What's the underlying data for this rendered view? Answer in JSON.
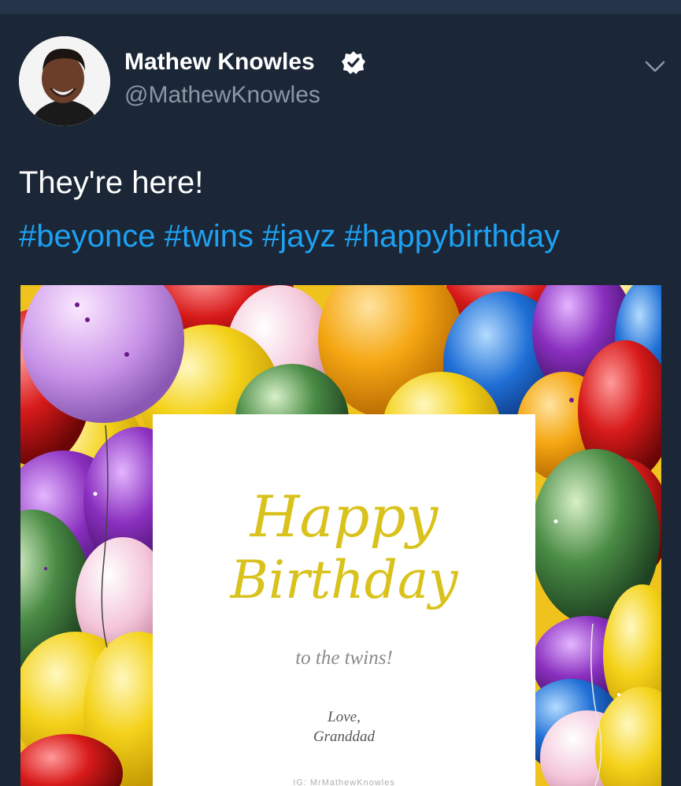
{
  "tweet": {
    "author_name": "Mathew Knowles",
    "handle": "@MathewKnowles",
    "text": "They're here!",
    "hashtags": [
      "#beyonce",
      "#twins",
      "#jayz",
      "#happybirthday"
    ]
  },
  "icons": {
    "verified": "verified-badge-icon",
    "menu": "chevron-down-icon"
  },
  "media": {
    "card": {
      "line1": "Happy",
      "line2": "Birthday",
      "subtitle": "to the twins!",
      "love": "Love,",
      "signature": "Granddad",
      "watermark": "IG: MrMathewKnowles"
    }
  },
  "colors": {
    "background": "#1b2636",
    "hashtag": "#1da1f2",
    "handle": "#8899a6",
    "card_text": "#d9c21b"
  }
}
